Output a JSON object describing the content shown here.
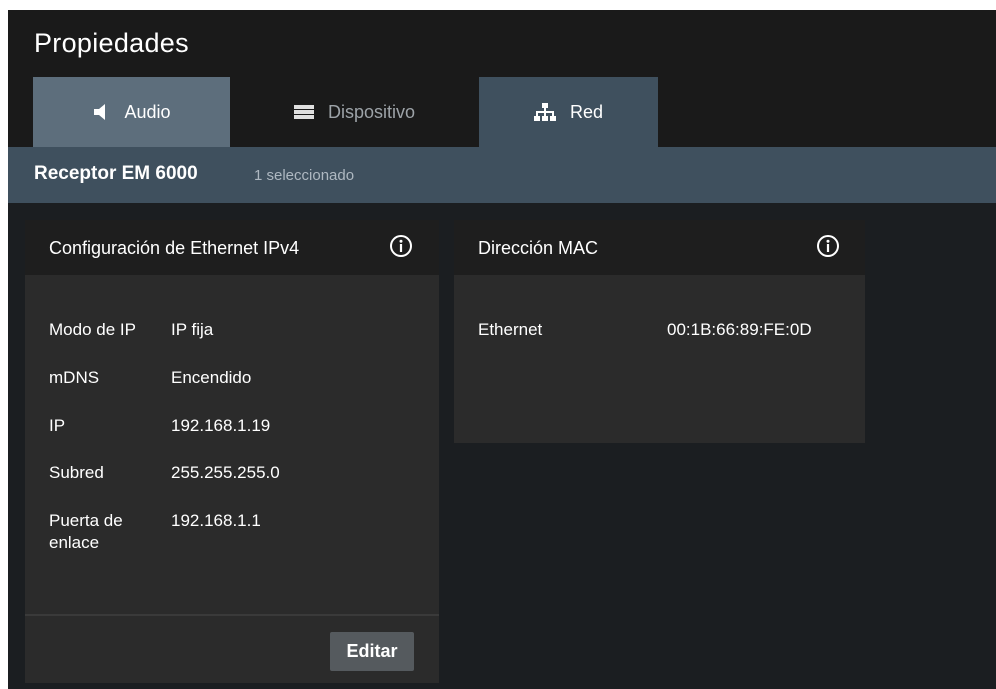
{
  "window": {
    "title": "Propiedades"
  },
  "tabs": [
    {
      "label": "Audio",
      "icon": "speaker-icon",
      "state": "hover"
    },
    {
      "label": "Dispositivo",
      "icon": "device-icon",
      "state": "inactive"
    },
    {
      "label": "Red",
      "icon": "network-icon",
      "state": "active"
    }
  ],
  "subheader": {
    "device": "Receptor EM 6000",
    "selection": "1 seleccionado"
  },
  "ipv4_card": {
    "title": "Configuración de Ethernet IPv4",
    "rows": [
      {
        "label": "Modo de IP",
        "value": "IP fija"
      },
      {
        "label": "mDNS",
        "value": "Encendido"
      },
      {
        "label": "IP",
        "value": "192.168.1.19"
      },
      {
        "label": "Subred",
        "value": "255.255.255.0"
      },
      {
        "label": "Puerta de enlace",
        "value": "192.168.1.1"
      }
    ],
    "edit_label": "Editar"
  },
  "mac_card": {
    "title": "Dirección MAC",
    "rows": [
      {
        "label": "Ethernet",
        "value": "00:1B:66:89:FE:0D"
      }
    ]
  },
  "colors": {
    "background": "#1b1e21",
    "title_bar": "#1a1a1a",
    "accent": "#3f505e",
    "tab_hover": "#5d6e7c",
    "card": "#2b2b2b",
    "card_header": "#1e1e1e"
  }
}
